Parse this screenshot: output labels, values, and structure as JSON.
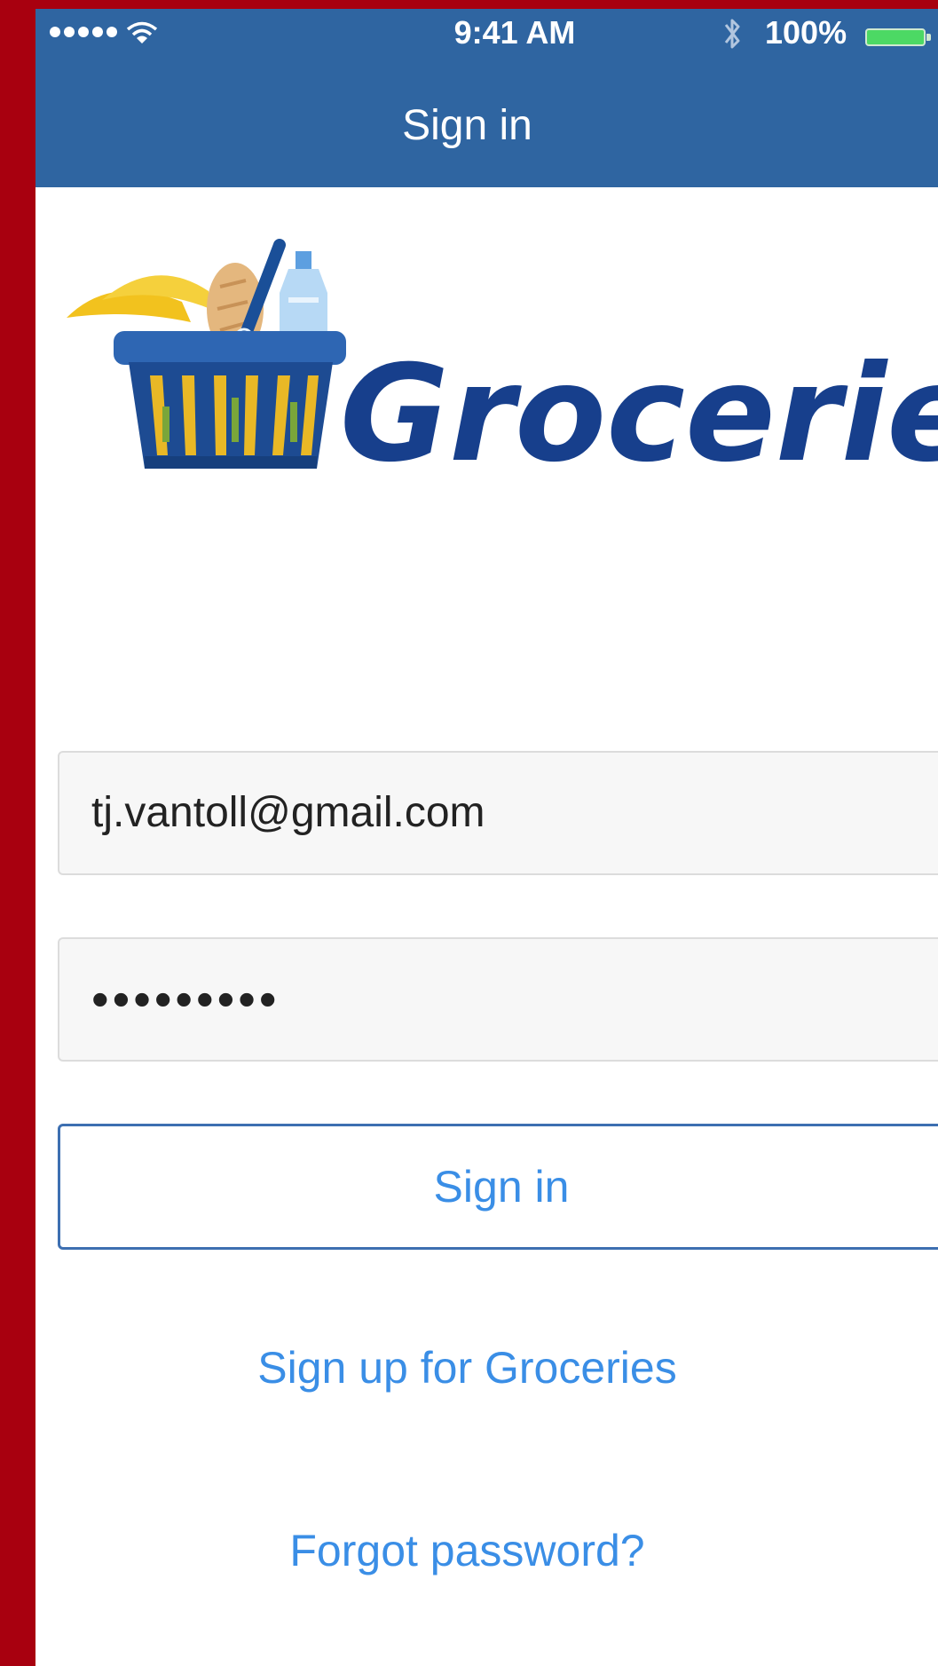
{
  "status_bar": {
    "time": "9:41 AM",
    "battery_percent": "100%",
    "battery_level": 1.0,
    "signal_bars": 5
  },
  "navbar": {
    "title": "Sign in",
    "color": "#2f65a1"
  },
  "logo": {
    "wordmark": "Groceries"
  },
  "form": {
    "email_value": "tj.vantoll@gmail.com",
    "password_value": "•••••••••",
    "signin_label": "Sign in"
  },
  "links": {
    "signup": "Sign up for Groceries",
    "forgot": "Forgot password?"
  },
  "colors": {
    "frame": "#a8000f",
    "accent": "#3a8ee6",
    "brand_dark": "#173f8c"
  }
}
